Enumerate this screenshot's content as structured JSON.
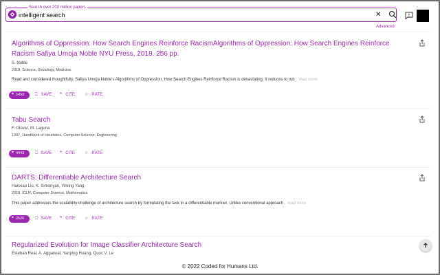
{
  "search": {
    "label": "Search over 200 million papers",
    "value": "intelligent search",
    "advanced_label": "Advanced"
  },
  "colors": {
    "accent": "#9c27b0"
  },
  "results": [
    {
      "title": "Algorithms of Oppression: How Search Engines Reinforce RacismAlgorithms of Oppression: How Search Engines Reinforce Racism Safiya Umoja Noble NYU Press, 2018. 256 pp.",
      "authors": "S. Noble",
      "meta": "2018, Science, Sociology, Medicine",
      "abstract": "Read and considered thoughtfully, Safiya Umoja Noble's Algorithms of Oppression: How Search Engines Reinforce Racism is devastating. It reduces to rub",
      "read_more": "read more",
      "citations": "1453"
    },
    {
      "title": "Tabu Search",
      "authors": "F. Glover, M. Laguna",
      "meta": "1997, Handbook of Heuristics, Computer Science, Engineering",
      "abstract": "",
      "read_more": "",
      "citations": "4443"
    },
    {
      "title": "DARTS: Differentiable Architecture Search",
      "authors": "Hanxiao Liu, K. Simonyan, Yiming Yang",
      "meta": "2018, ICLR, Computer Science, Mathematics",
      "abstract": "This paper addresses the scalability challenge of architecture search by formulating the task in a differentiable manner. Unlike conventional approach",
      "read_more": "read more",
      "citations": "2526"
    },
    {
      "title": "Regularized Evolution for Image Classifier Architecture Search",
      "authors": "Esteban Real, A. Aggarwal, Yanping Huang, Quoc V. Le",
      "meta": "",
      "abstract": "",
      "read_more": "",
      "citations": ""
    }
  ],
  "actions": {
    "save": "SAVE",
    "cite": "CITE",
    "rate": "RATE"
  },
  "footer": {
    "text": "© 2022 Coded for Humans Ltd."
  }
}
